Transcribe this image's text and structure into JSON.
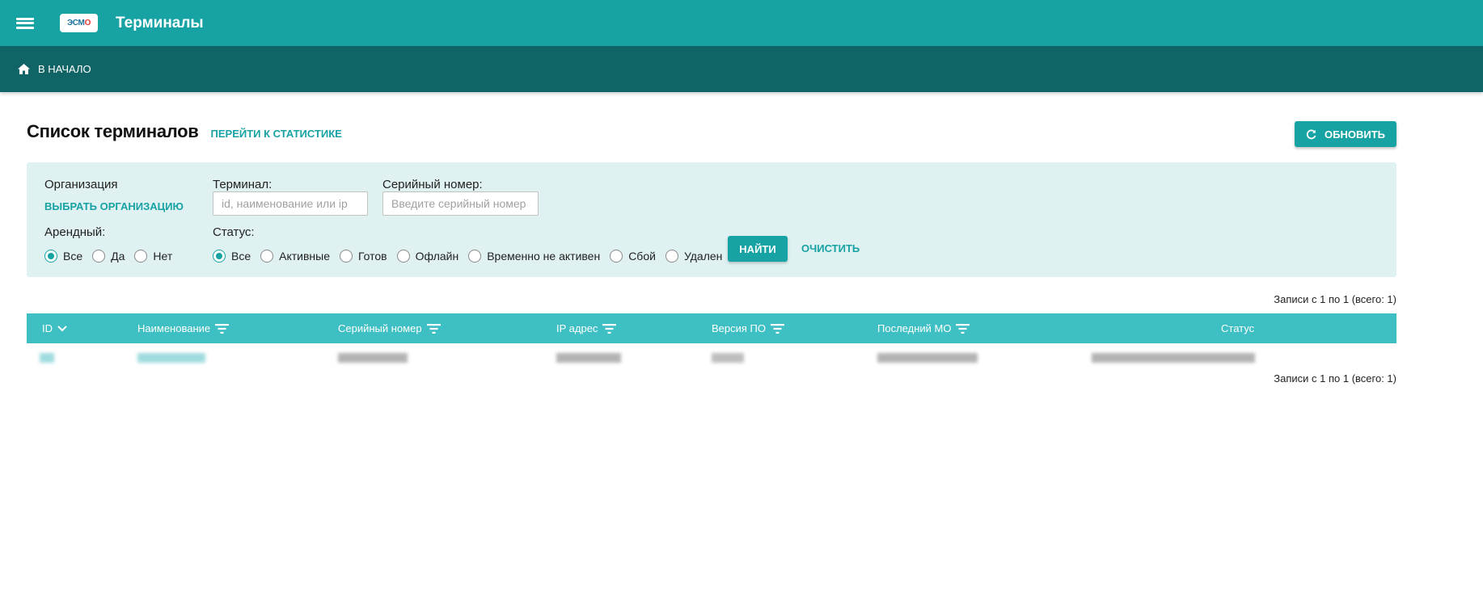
{
  "app": {
    "title": "Терминалы",
    "logo_text_1": "ЭСМ",
    "logo_text_2": "О",
    "brand_color": "#17a2a4"
  },
  "nav": {
    "home_label": "В НАЧАЛО"
  },
  "page": {
    "title": "Список терминалов",
    "stats_link": "ПЕРЕЙТИ К СТАТИСТИКЕ",
    "refresh_label": "ОБНОВИТЬ"
  },
  "filters": {
    "org_label": "Организация",
    "org_link": "ВЫБРАТЬ ОРГАНИЗАЦИЮ",
    "terminal_label": "Терминал:",
    "terminal_placeholder": "id, наименование или ip",
    "terminal_value": "",
    "serial_label": "Серийный номер:",
    "serial_placeholder": "Введите серийный номер",
    "serial_value": "",
    "rent_label": "Арендный:",
    "rent_options": [
      "Все",
      "Да",
      "Нет"
    ],
    "rent_selected": "Все",
    "status_label": "Статус:",
    "status_options": [
      "Все",
      "Активные",
      "Готов",
      "Офлайн",
      "Временно не активен",
      "Сбой",
      "Удален"
    ],
    "status_selected": "Все",
    "find_label": "НАЙТИ",
    "clear_label": "ОЧИСТИТЬ"
  },
  "table": {
    "records_top": "Записи с 1 по 1 (всего: 1)",
    "records_bottom": "Записи с 1 по 1 (всего: 1)",
    "columns": [
      "ID",
      "Наименование",
      "Серийный номер",
      "IP адрес",
      "Версия ПО",
      "Последний МО",
      "Статус"
    ],
    "sort_icon": "chevron-down-icon",
    "filter_icon": "filter-icon"
  }
}
